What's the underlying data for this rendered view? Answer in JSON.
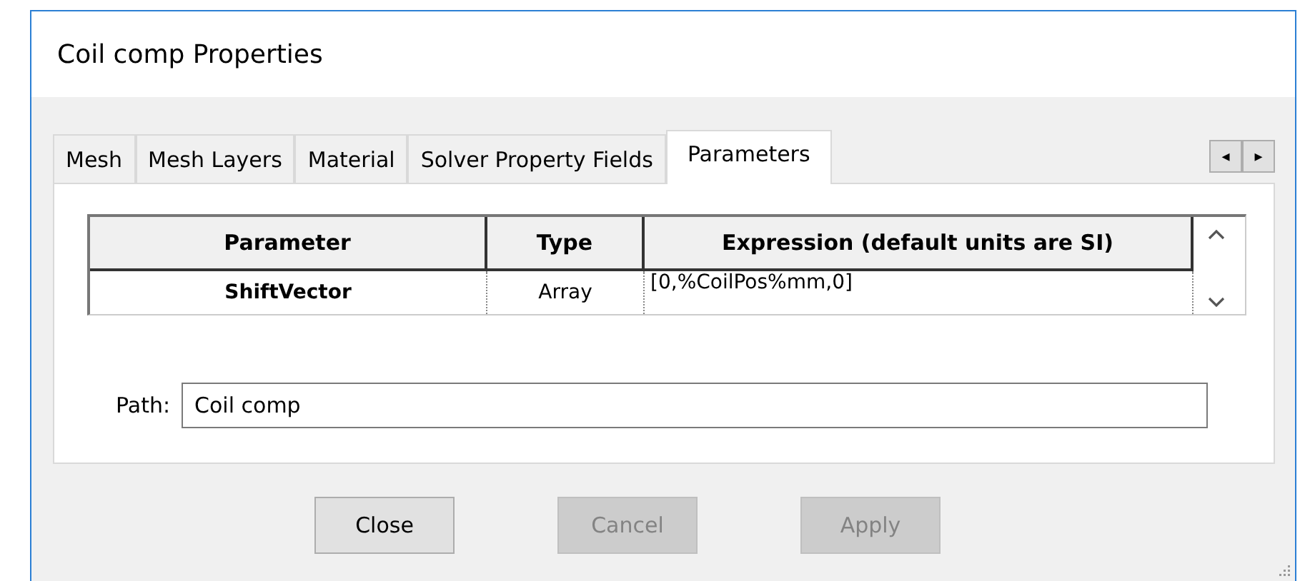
{
  "window": {
    "title": "Coil comp Properties"
  },
  "tabs": [
    {
      "label": "Mesh",
      "selected": false
    },
    {
      "label": "Mesh Layers",
      "selected": false
    },
    {
      "label": "Material",
      "selected": false
    },
    {
      "label": "Solver Property Fields",
      "selected": false
    },
    {
      "label": "Parameters",
      "selected": true
    }
  ],
  "tab_scroll": [
    "◂",
    "▸"
  ],
  "table": {
    "columns": [
      "Parameter",
      "Type",
      "Expression (default units are SI)"
    ],
    "rows": [
      [
        "ShiftVector",
        "Array",
        "[0,%CoilPos%mm,0]"
      ]
    ]
  },
  "path": {
    "label": "Path:",
    "value": "Coil comp"
  },
  "buttons": [
    {
      "label": "Close",
      "disabled": false
    },
    {
      "label": "Cancel",
      "disabled": true
    },
    {
      "label": "Apply",
      "disabled": true
    }
  ]
}
